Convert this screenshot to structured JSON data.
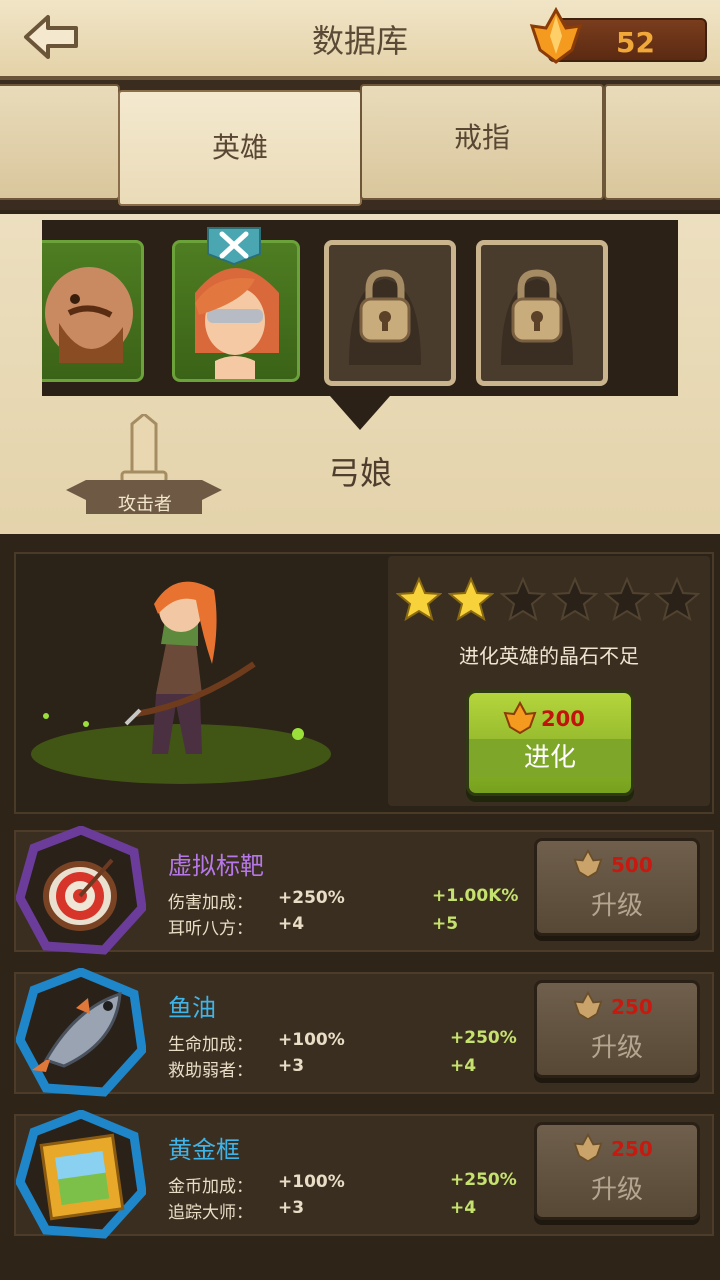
{
  "header": {
    "title": "数据库",
    "gem_count": "52"
  },
  "tabs": [
    {
      "label": ""
    },
    {
      "label": "英雄",
      "active": true
    },
    {
      "label": "戒指"
    },
    {
      "label": ""
    }
  ],
  "hero_list": [
    {
      "state": "owned",
      "portrait": "bearded-warrior"
    },
    {
      "state": "owned",
      "portrait": "archer-girl",
      "selected": true
    },
    {
      "state": "locked"
    },
    {
      "state": "locked"
    }
  ],
  "hero": {
    "name": "弓娘",
    "role": "攻击者",
    "stars_filled": 2,
    "stars_total": 6,
    "evolve_message": "进化英雄的晶石不足",
    "evolve_cost": "200",
    "evolve_label": "进化"
  },
  "items": [
    {
      "name": "虚拟标靶",
      "name_color": "#b678e8",
      "frame_color": "#6b3c9a",
      "icon": "target-icon",
      "stats": [
        {
          "label": "伤害加成：",
          "value": "+250%",
          "next": "+1.00K%"
        },
        {
          "label": "耳听八方：",
          "value": "+4",
          "next": "+5"
        }
      ],
      "cost": "500",
      "button_label": "升级"
    },
    {
      "name": "鱼油",
      "name_color": "#3fb4e8",
      "frame_color": "#1e86c9",
      "icon": "fish-icon",
      "stats": [
        {
          "label": "生命加成：",
          "value": "+100%",
          "next": "+250%"
        },
        {
          "label": "救助弱者：",
          "value": "+3",
          "next": "+4"
        }
      ],
      "cost": "250",
      "button_label": "升级"
    },
    {
      "name": "黄金框",
      "name_color": "#3fb4e8",
      "frame_color": "#1e86c9",
      "icon": "golden-frame-icon",
      "stats": [
        {
          "label": "金币加成：",
          "value": "+100%",
          "next": "+250%"
        },
        {
          "label": "追踪大师：",
          "value": "+3",
          "next": "+4"
        }
      ],
      "cost": "250",
      "button_label": "升级"
    }
  ]
}
